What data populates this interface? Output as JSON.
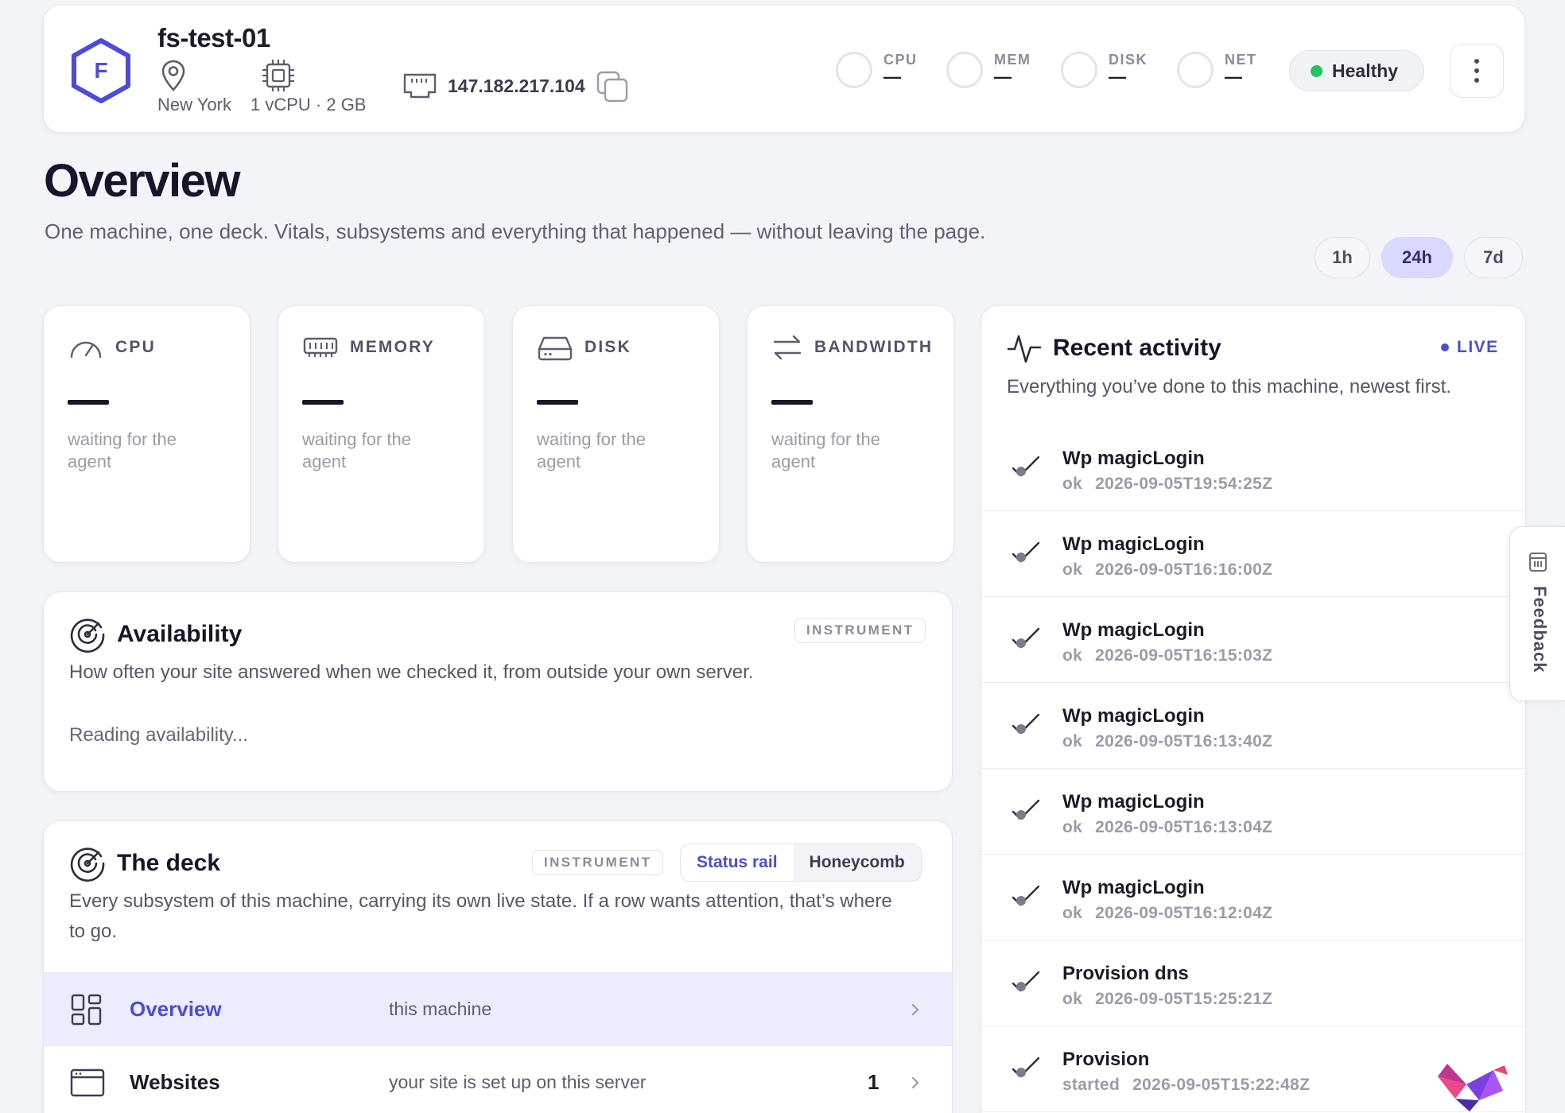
{
  "header": {
    "logo_letter": "F",
    "machine_name": "fs-test-01",
    "location": "New York",
    "spec": "1 vCPU · 2 GB",
    "ip": "147.182.217.104",
    "vitals": [
      {
        "label": "CPU",
        "value": "—"
      },
      {
        "label": "MEM",
        "value": "—"
      },
      {
        "label": "DISK",
        "value": "—"
      },
      {
        "label": "NET",
        "value": "—"
      }
    ],
    "status": "Healthy",
    "status_color": "#22c55e"
  },
  "page": {
    "title": "Overview",
    "subtitle": "One machine, one deck. Vitals, subsystems and everything that happened — without leaving the page.",
    "ranges": [
      {
        "label": "1h",
        "active": false
      },
      {
        "label": "24h",
        "active": true
      },
      {
        "label": "7d",
        "active": false
      }
    ]
  },
  "metrics": [
    {
      "label": "CPU",
      "value": "—",
      "note": "waiting for the agent",
      "icon": "gauge-icon"
    },
    {
      "label": "MEMORY",
      "value": "—",
      "note": "waiting for the agent",
      "icon": "memory-icon"
    },
    {
      "label": "DISK",
      "value": "—",
      "note": "waiting for the agent",
      "icon": "disk-icon"
    },
    {
      "label": "BANDWIDTH",
      "value": "—",
      "note": "waiting for the agent",
      "icon": "arrows-exchange-icon"
    }
  ],
  "availability": {
    "title": "Availability",
    "badge": "INSTRUMENT",
    "description": "How often your site answered when we checked it, from outside your own server.",
    "loading": "Reading availability..."
  },
  "deck": {
    "title": "The deck",
    "badge": "INSTRUMENT",
    "views": [
      {
        "label": "Status rail",
        "active": true
      },
      {
        "label": "Honeycomb",
        "active": false
      }
    ],
    "description": "Every subsystem of this machine, carrying its own live state. If a row wants attention, that’s where to go.",
    "rows": [
      {
        "name": "Overview",
        "desc": "this machine",
        "count": "",
        "active": true,
        "icon": "grid-icon"
      },
      {
        "name": "Websites",
        "desc": "your site is set up on this server",
        "count": "1",
        "active": false,
        "icon": "browser-window-icon"
      }
    ]
  },
  "activity": {
    "title": "Recent activity",
    "live_label": "LIVE",
    "description": "Everything you’ve done to this machine, newest first.",
    "items": [
      {
        "name": "Wp magicLogin",
        "status": "ok",
        "time": "2026-09-05T19:54:25Z"
      },
      {
        "name": "Wp magicLogin",
        "status": "ok",
        "time": "2026-09-05T16:16:00Z"
      },
      {
        "name": "Wp magicLogin",
        "status": "ok",
        "time": "2026-09-05T16:15:03Z"
      },
      {
        "name": "Wp magicLogin",
        "status": "ok",
        "time": "2026-09-05T16:13:40Z"
      },
      {
        "name": "Wp magicLogin",
        "status": "ok",
        "time": "2026-09-05T16:13:04Z"
      },
      {
        "name": "Wp magicLogin",
        "status": "ok",
        "time": "2026-09-05T16:12:04Z"
      },
      {
        "name": "Provision dns",
        "status": "ok",
        "time": "2026-09-05T15:25:21Z"
      },
      {
        "name": "Provision",
        "status": "started",
        "time": "2026-09-05T15:22:48Z"
      }
    ]
  },
  "feedback": {
    "label": "Feedback"
  },
  "colors": {
    "accent": "#4b4be0",
    "accent_soft": "#d9d8ff",
    "background": "#f3f4f8"
  }
}
